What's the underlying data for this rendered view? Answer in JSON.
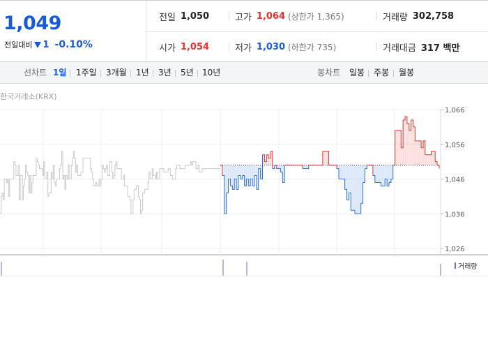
{
  "summary": {
    "current_price": "1,049",
    "change_label": "전일대비",
    "change_icon": "down-triangle-icon",
    "change_amount": "1",
    "change_percent": "-0.10%",
    "prev_close_label": "전일",
    "prev_close": "1,050",
    "open_label": "시가",
    "open": "1,054",
    "high_label": "고가",
    "high": "1,064",
    "upper_limit_note": "(상한가 1,365)",
    "low_label": "저가",
    "low": "1,030",
    "lower_limit_note": "(하한가 735)",
    "volume_label": "거래량",
    "volume": "302,758",
    "turnover_label": "거래대금",
    "turnover": "317 백만",
    "colors": {
      "up": "#e5322d",
      "down": "#1a5bd8"
    }
  },
  "toolbar": {
    "line_chart_label": "선차트",
    "periods": [
      "1일",
      "1주일",
      "3개월",
      "1년",
      "3년",
      "5년",
      "10년"
    ],
    "active_period": "1일",
    "candle_chart_label": "봉차트",
    "candle_periods": [
      "일봉",
      "주봉",
      "월봉"
    ]
  },
  "chart": {
    "source": "한국거래소(KRX)",
    "volume_legend": "거래량"
  },
  "chart_data": {
    "type": "line",
    "yticks": [
      "1,066",
      "1,056",
      "1,046",
      "1,036",
      "1,026"
    ],
    "ylim": [
      1026,
      1066
    ],
    "baseline": 1050,
    "grid": true,
    "series": [
      {
        "values": [
          1036,
          1041,
          1042,
          1040,
          1046,
          1046,
          1045,
          1046,
          1041,
          1046,
          1046,
          1046,
          1046,
          1051,
          1050,
          1047,
          1047,
          1050,
          1040,
          1047,
          1047,
          1040,
          1044,
          1046,
          1050,
          1048,
          1047,
          1042,
          1047,
          1042,
          1045,
          1047,
          1047,
          1047,
          1052,
          1051,
          1050,
          1049,
          1049,
          1049,
          1047,
          1051,
          1046,
          1046,
          1048,
          1041,
          1042,
          1042,
          1048,
          1046,
          1050,
          1045,
          1044,
          1046,
          1046,
          1046,
          1049,
          1050,
          1054,
          1046,
          1047,
          1043,
          1047,
          1046,
          1050,
          1046,
          1046,
          1050,
          1052,
          1054,
          1052,
          1048,
          1050,
          1047,
          1047,
          1047,
          1048,
          1048,
          1052,
          1052,
          1052,
          1052,
          1052,
          1052,
          1052,
          1049,
          1048,
          1046,
          1044,
          1044,
          1045,
          1044,
          1044,
          1046,
          1044,
          1046,
          1050,
          1049,
          1048,
          1049,
          1050,
          1047,
          1047,
          1051,
          1051,
          1048,
          1046,
          1047,
          1050,
          1051,
          1049,
          1049,
          1049,
          1049,
          1046,
          1046,
          1047,
          1044,
          1044,
          1044,
          1041,
          1041,
          1040,
          1036,
          1036,
          1040,
          1043,
          1043,
          1044,
          1044,
          1041,
          1040,
          1036,
          1037,
          1042,
          1042,
          1043,
          1043,
          1043,
          1045,
          1048,
          1046,
          1046,
          1049,
          1047,
          1047,
          1046,
          1048,
          1046,
          1046,
          1049,
          1049,
          1049,
          1049,
          1048,
          1048,
          1048,
          1048,
          1049,
          1049,
          1047,
          1047,
          1046,
          1046,
          1046,
          1049,
          1050,
          1050,
          1050,
          1049,
          1049,
          1049,
          1049,
          1049,
          1050,
          1050,
          1050,
          1050,
          1050,
          1051,
          1050,
          1051,
          1051,
          1051,
          1049,
          1049,
          1050,
          1048,
          1048,
          1048,
          1049,
          1049,
          1049,
          1049,
          1049,
          1049,
          1049,
          1049,
          1049,
          1049,
          1049,
          1049,
          1049,
          1049,
          1049,
          1049,
          1049,
          1049
        ]
      },
      {
        "values": [
          1050,
          1047,
          1036,
          1042,
          1046,
          1044,
          1043,
          1046,
          1043,
          1047,
          1046,
          1047,
          1044,
          1046,
          1044,
          1046,
          1044,
          1047,
          1043,
          1049,
          1046,
          1053,
          1051,
          1053,
          1052,
          1054,
          1049,
          1050,
          1049,
          1049,
          1048,
          1045,
          1050,
          1050,
          1050,
          1050,
          1050,
          1050,
          1050,
          1050,
          1050,
          1049,
          1049,
          1049,
          1050,
          1050,
          1050,
          1050,
          1050,
          1050,
          1050,
          1054,
          1054,
          1054,
          1050,
          1050,
          1050,
          1050,
          1049,
          1046,
          1046,
          1046,
          1043,
          1040,
          1042,
          1037,
          1037,
          1036,
          1036,
          1036,
          1039,
          1045,
          1049,
          1050,
          1050,
          1050,
          1047,
          1045,
          1045,
          1045,
          1044,
          1044,
          1046,
          1044,
          1045,
          1046,
          1050,
          1060,
          1060,
          1060,
          1055,
          1063,
          1064,
          1062,
          1060,
          1063,
          1061,
          1057,
          1057,
          1057,
          1055,
          1057,
          1053,
          1053,
          1053,
          1054,
          1054,
          1051,
          1050,
          1049
        ]
      }
    ]
  }
}
